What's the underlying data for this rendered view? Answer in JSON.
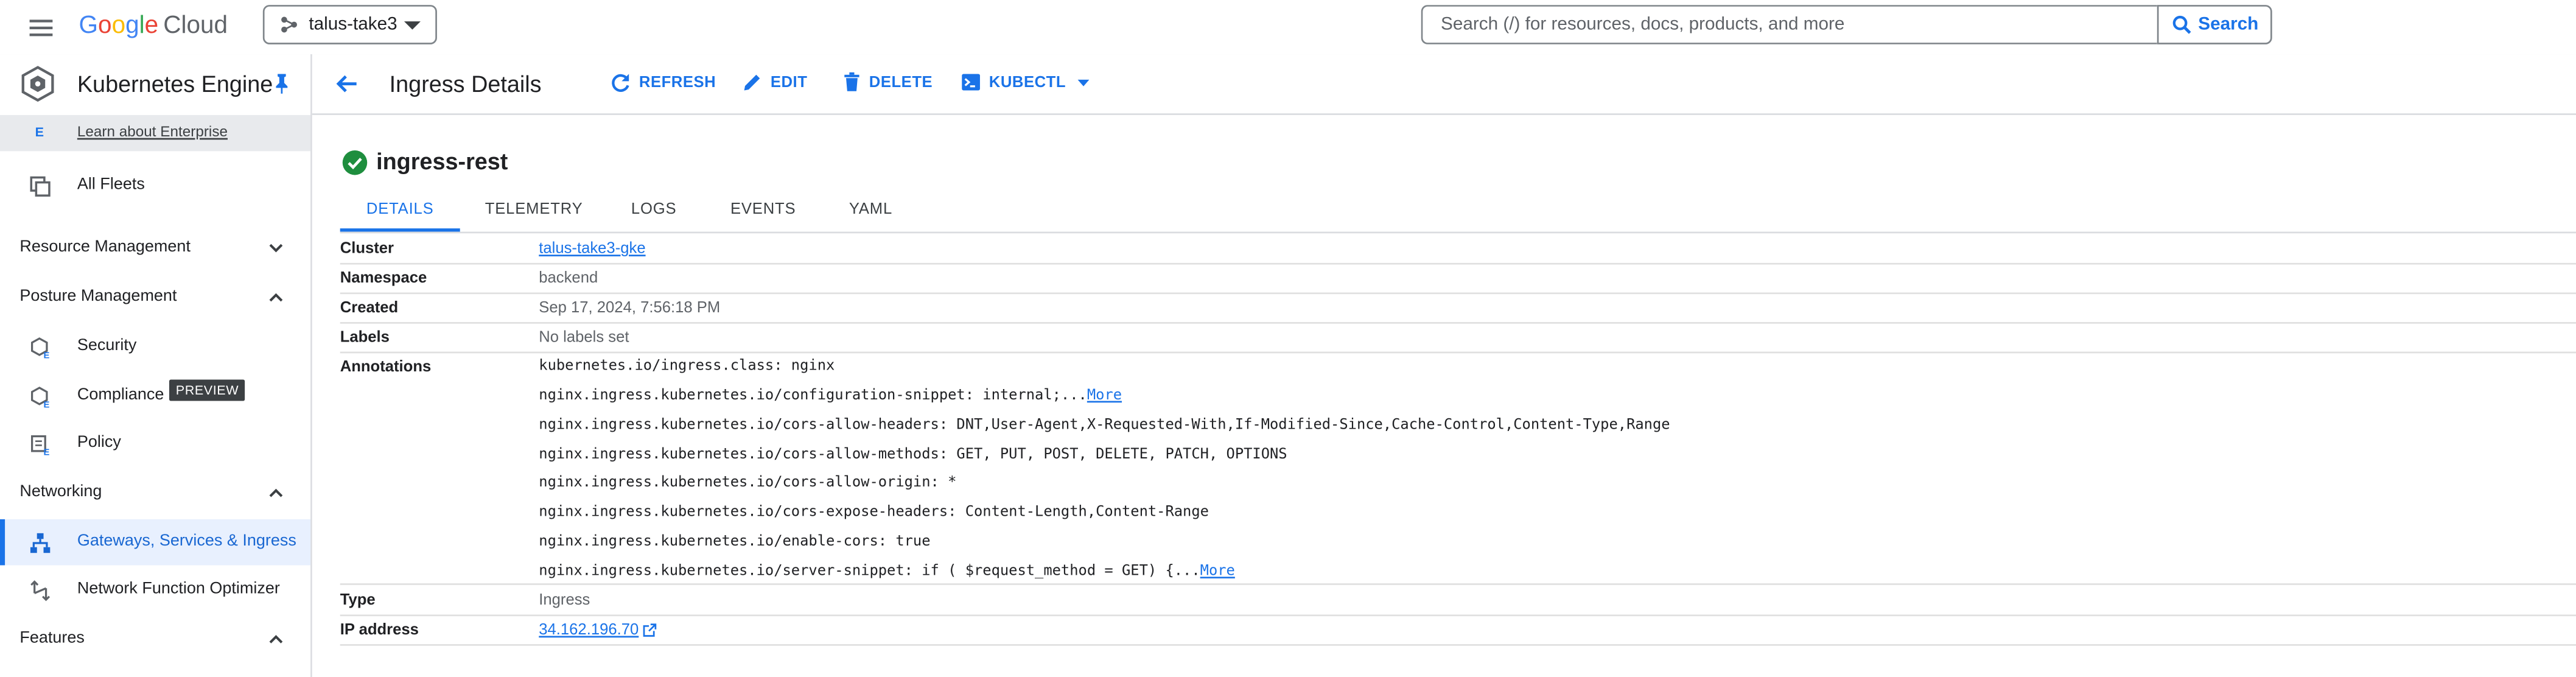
{
  "topbar": {
    "brand": {
      "g1": "G",
      "g2": "o",
      "g3": "o",
      "g4": "g",
      "g5": "l",
      "g6": "e",
      "product": "Cloud"
    },
    "project": "talus-take3",
    "search_placeholder": "Search (/) for resources, docs, products, and more",
    "search_button": "Search"
  },
  "sidebar": {
    "title": "Kubernetes Engine",
    "enterprise_badge": "E",
    "enterprise_link": "Learn about Enterprise",
    "all_fleets": "All Fleets",
    "sections": {
      "resource_management": "Resource Management",
      "posture_management": "Posture Management",
      "networking": "Networking",
      "features": "Features"
    },
    "posture_items": {
      "security": "Security",
      "compliance": "Compliance",
      "compliance_badge": "PREVIEW",
      "policy": "Policy"
    },
    "networking_items": {
      "gateways": "Gateways, Services & Ingress",
      "nfo": "Network Function Optimizer"
    }
  },
  "header": {
    "title": "Ingress Details",
    "actions": {
      "refresh": "REFRESH",
      "edit": "EDIT",
      "delete": "DELETE",
      "kubectl": "KUBECTL"
    }
  },
  "resource": {
    "name": "ingress-rest",
    "tabs": [
      "DETAILS",
      "TELEMETRY",
      "LOGS",
      "EVENTS",
      "YAML"
    ],
    "active_tab": "DETAILS"
  },
  "details": {
    "cluster_label": "Cluster",
    "cluster": "talus-take3-gke",
    "namespace_label": "Namespace",
    "namespace": "backend",
    "created_label": "Created",
    "created": "Sep 17, 2024, 7:56:18 PM",
    "labels_label": "Labels",
    "labels": "No labels set",
    "annotations_label": "Annotations",
    "annotations": [
      "kubernetes.io/ingress.class: nginx",
      "nginx.ingress.kubernetes.io/configuration-snippet: internal;...",
      "nginx.ingress.kubernetes.io/cors-allow-headers: DNT,User-Agent,X-Requested-With,If-Modified-Since,Cache-Control,Content-Type,Range",
      "nginx.ingress.kubernetes.io/cors-allow-methods: GET, PUT, POST, DELETE, PATCH, OPTIONS",
      "nginx.ingress.kubernetes.io/cors-allow-origin: *",
      "nginx.ingress.kubernetes.io/cors-expose-headers: Content-Length,Content-Range",
      "nginx.ingress.kubernetes.io/enable-cors: true",
      "nginx.ingress.kubernetes.io/server-snippet: if ( $request_method = GET) {..."
    ],
    "more_label": "More",
    "type_label": "Type",
    "type": "Ingress",
    "ip_label": "IP address",
    "ip": "34.162.196.70"
  },
  "colors": {
    "accent": "#1a73e8",
    "success": "#1e8e3e",
    "text": "#202124",
    "muted": "#5f6368"
  },
  "icons": {
    "menu": "hamburger-menu-icon",
    "project": "project-tree-icon",
    "search": "search-icon",
    "product": "kubernetes-engine-icon",
    "pin": "pin-icon",
    "back": "arrow-back-icon",
    "refresh": "refresh-icon",
    "edit": "pencil-icon",
    "delete": "trash-icon",
    "kubectl": "terminal-icon",
    "status": "check-circle-icon",
    "external": "open-in-new-icon"
  }
}
